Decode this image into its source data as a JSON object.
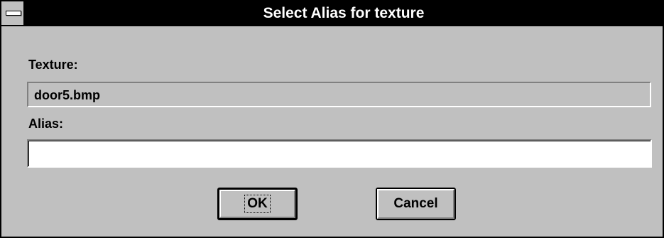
{
  "window": {
    "title": "Select Alias for texture"
  },
  "texture": {
    "label": "Texture:",
    "value": "door5.bmp"
  },
  "alias": {
    "label": "Alias:",
    "value": ""
  },
  "buttons": {
    "ok_label": "OK",
    "cancel_label": "Cancel"
  },
  "colors": {
    "face": "#c0c0c0",
    "titlebar": "#000000",
    "title_text": "#ffffff",
    "input_bg": "#ffffff"
  }
}
